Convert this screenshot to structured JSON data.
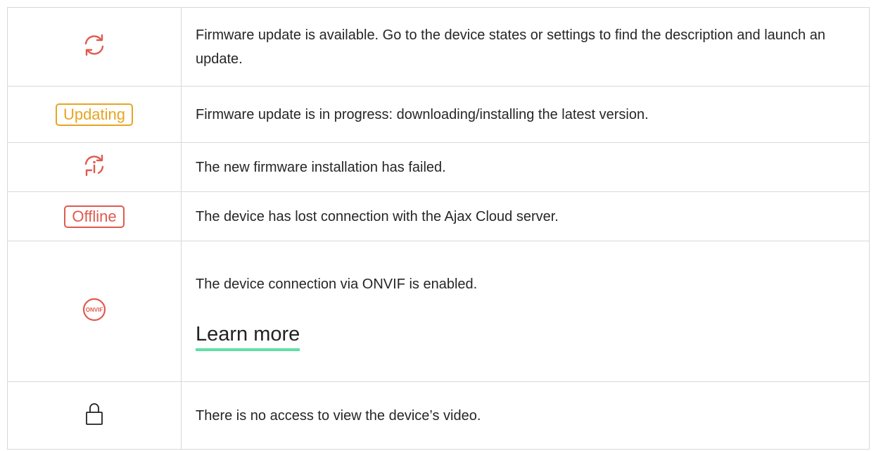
{
  "rows": [
    {
      "icon": "refresh-icon",
      "description": "Firmware update is available. Go to the device states or settings to find the description and launch an update."
    },
    {
      "badge": "Updating",
      "badge_color": "#e8a521",
      "description": "Firmware update is in progress: downloading/installing the latest version."
    },
    {
      "icon": "update-failed-icon",
      "description": "The new firmware installation has failed."
    },
    {
      "badge": "Offline",
      "badge_color": "#e05a4f",
      "description": "The device has lost connection with the Ajax Cloud server."
    },
    {
      "icon": "onvif-icon",
      "icon_text": "ONVIF",
      "description": "The device connection via ONVIF is enabled.",
      "link": "Learn more"
    },
    {
      "icon": "lock-icon",
      "description": "There is no access to view the device’s video."
    }
  ],
  "colors": {
    "accent_red": "#e05a4f",
    "accent_yellow": "#e8a521",
    "link_underline": "#5ee0a4",
    "border": "#d8d8d8"
  }
}
